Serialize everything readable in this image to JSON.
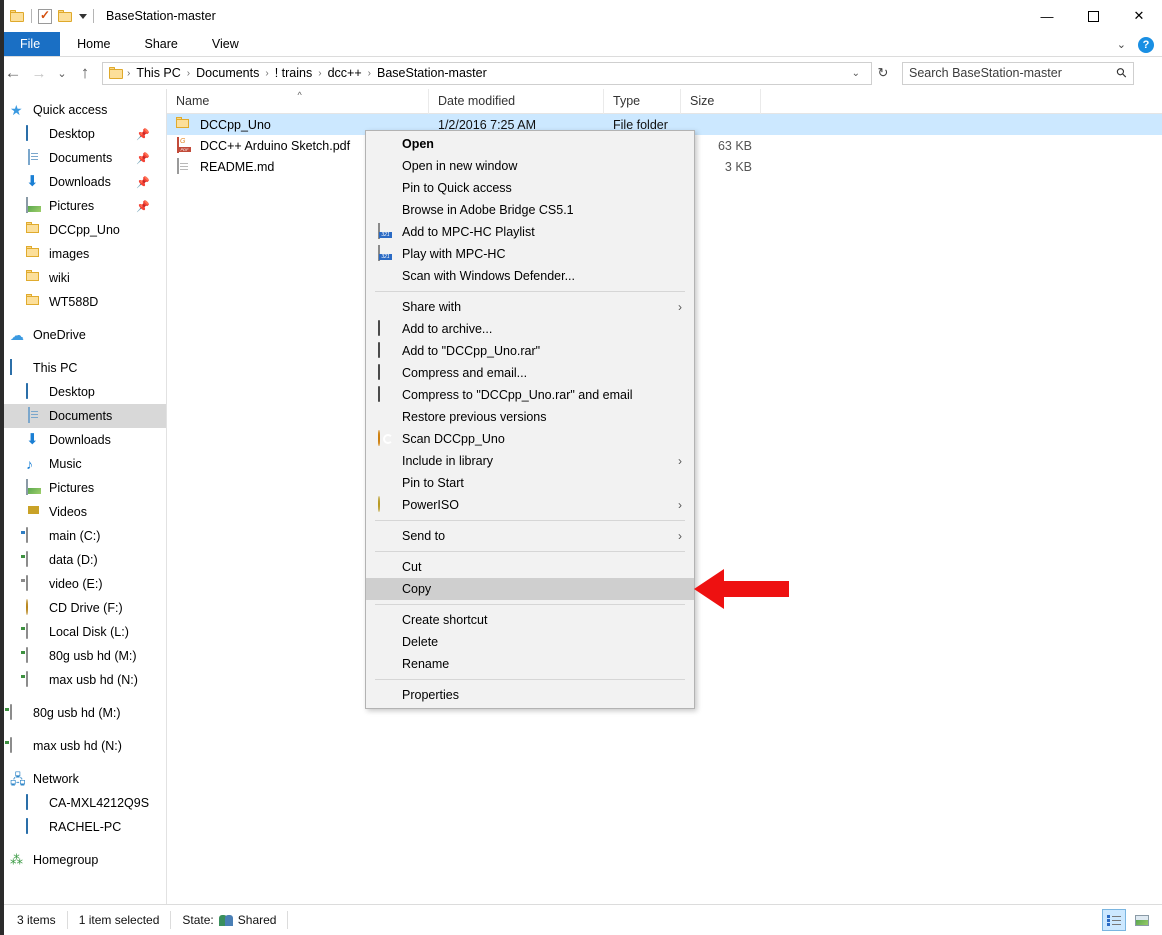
{
  "window": {
    "title": "BaseStation-master",
    "quick_access_icons": [
      "folder-icon",
      "properties-icon",
      "new-folder-icon",
      "customize-caret-icon"
    ],
    "controls": {
      "minimize": "—",
      "maximize": "▢",
      "close": "✕"
    }
  },
  "ribbon": {
    "tabs": [
      {
        "label": "File",
        "active_style": "blue"
      },
      {
        "label": "Home"
      },
      {
        "label": "Share"
      },
      {
        "label": "View"
      }
    ],
    "collapse_icon": "chevron-down-icon",
    "help_icon": "help-icon",
    "help_label": "?"
  },
  "address_bar": {
    "back_icon": "back-arrow-icon",
    "forward_icon": "forward-arrow-icon",
    "recent_icon": "recent-locations-icon",
    "up_icon": "up-arrow-icon",
    "breadcrumbs": [
      "This PC",
      "Documents",
      "! trains",
      "dcc++",
      "BaseStation-master"
    ],
    "separator": "›",
    "dropdown_icon": "address-dropdown-icon",
    "refresh_icon": "refresh-icon",
    "refresh_glyph": "↻"
  },
  "search": {
    "placeholder": "Search BaseStation-master",
    "icon": "search-icon"
  },
  "navigation_pane": {
    "groups": [
      {
        "header": {
          "label": "Quick access",
          "icon": "quick-access-star-icon"
        },
        "items": [
          {
            "label": "Desktop",
            "icon": "desktop-icon",
            "pinned": true
          },
          {
            "label": "Documents",
            "icon": "documents-icon",
            "pinned": true
          },
          {
            "label": "Downloads",
            "icon": "downloads-icon",
            "pinned": true
          },
          {
            "label": "Pictures",
            "icon": "pictures-icon",
            "pinned": true
          },
          {
            "label": "DCCpp_Uno",
            "icon": "folder-icon",
            "pinned": false
          },
          {
            "label": "images",
            "icon": "folder-icon",
            "pinned": false
          },
          {
            "label": "wiki",
            "icon": "folder-icon",
            "pinned": false
          },
          {
            "label": "WT588D",
            "icon": "folder-icon",
            "pinned": false
          }
        ]
      },
      {
        "header": {
          "label": "OneDrive",
          "icon": "onedrive-cloud-icon"
        },
        "items": []
      },
      {
        "header": {
          "label": "This PC",
          "icon": "this-pc-icon"
        },
        "items": [
          {
            "label": "Desktop",
            "icon": "desktop-icon"
          },
          {
            "label": "Documents",
            "icon": "documents-icon",
            "selected": true
          },
          {
            "label": "Downloads",
            "icon": "downloads-icon"
          },
          {
            "label": "Music",
            "icon": "music-icon"
          },
          {
            "label": "Pictures",
            "icon": "pictures-icon"
          },
          {
            "label": "Videos",
            "icon": "videos-icon"
          },
          {
            "label": "main (C:)",
            "icon": "system-drive-icon"
          },
          {
            "label": "data (D:)",
            "icon": "drive-icon"
          },
          {
            "label": "video (E:)",
            "icon": "drive-icon"
          },
          {
            "label": "CD Drive (F:)",
            "icon": "cd-drive-icon"
          },
          {
            "label": "Local Disk (L:)",
            "icon": "drive-icon"
          },
          {
            "label": "80g usb hd (M:)",
            "icon": "drive-icon"
          },
          {
            "label": "max usb hd (N:)",
            "icon": "drive-icon"
          }
        ]
      },
      {
        "header": null,
        "items": [
          {
            "label": "80g usb hd (M:)",
            "icon": "drive-icon",
            "top_level": true
          },
          {
            "label": "max usb hd (N:)",
            "icon": "drive-icon",
            "top_level": true
          }
        ]
      },
      {
        "header": {
          "label": "Network",
          "icon": "network-icon"
        },
        "items": [
          {
            "label": "CA-MXL4212Q9S",
            "icon": "computer-icon"
          },
          {
            "label": "RACHEL-PC",
            "icon": "computer-icon"
          }
        ]
      },
      {
        "header": {
          "label": "Homegroup",
          "icon": "homegroup-icon"
        },
        "items": []
      }
    ]
  },
  "file_list": {
    "columns": [
      {
        "label": "Name",
        "sorted": true,
        "sort_glyph": "^"
      },
      {
        "label": "Date modified"
      },
      {
        "label": "Type"
      },
      {
        "label": "Size"
      }
    ],
    "rows": [
      {
        "name": "DCCpp_Uno",
        "icon": "folder-icon",
        "date_modified": "1/2/2016 7:25 AM",
        "type": "File folder",
        "size": "",
        "selected": true
      },
      {
        "name": "DCC++ Arduino Sketch.pdf",
        "icon": "pdf-file-icon",
        "date_modified": "",
        "type": "",
        "size": "63 KB",
        "selected": false
      },
      {
        "name": "README.md",
        "icon": "markdown-file-icon",
        "date_modified": "",
        "type": "",
        "size": "3 KB",
        "selected": false
      }
    ]
  },
  "context_menu": {
    "items": [
      {
        "label": "Open",
        "bold": true
      },
      {
        "label": "Open in new window"
      },
      {
        "label": "Pin to Quick access"
      },
      {
        "label": "Browse in Adobe Bridge CS5.1"
      },
      {
        "label": "Add to MPC-HC Playlist",
        "icon": "mpc-hc-icon"
      },
      {
        "label": "Play with MPC-HC",
        "icon": "mpc-hc-icon"
      },
      {
        "label": "Scan with Windows Defender..."
      },
      {
        "separator": true
      },
      {
        "label": "Share with",
        "submenu": true
      },
      {
        "label": "Add to archive...",
        "icon": "winrar-icon"
      },
      {
        "label": "Add to \"DCCpp_Uno.rar\"",
        "icon": "winrar-icon"
      },
      {
        "label": "Compress and email...",
        "icon": "winrar-icon"
      },
      {
        "label": "Compress to \"DCCpp_Uno.rar\" and email",
        "icon": "winrar-icon"
      },
      {
        "label": "Restore previous versions"
      },
      {
        "label": "Scan DCCpp_Uno",
        "icon": "scan-icon"
      },
      {
        "label": "Include in library",
        "submenu": true
      },
      {
        "label": "Pin to Start"
      },
      {
        "label": "PowerISO",
        "icon": "poweriso-icon",
        "submenu": true
      },
      {
        "separator": true
      },
      {
        "label": "Send to",
        "submenu": true
      },
      {
        "separator": true
      },
      {
        "label": "Cut"
      },
      {
        "label": "Copy",
        "highlighted": true
      },
      {
        "separator": true
      },
      {
        "label": "Create shortcut"
      },
      {
        "label": "Delete"
      },
      {
        "label": "Rename"
      },
      {
        "separator": true
      },
      {
        "label": "Properties"
      }
    ],
    "submenu_glyph": "›"
  },
  "annotation": {
    "type": "red-arrow",
    "direction": "left",
    "color": "#ee1111",
    "points_at": "Copy"
  },
  "status_bar": {
    "item_count": "3 items",
    "selection": "1 item selected",
    "state_label": "State:",
    "state_value": "Shared",
    "state_icon": "shared-people-icon",
    "view_buttons": [
      {
        "name": "details-view",
        "active": true
      },
      {
        "name": "large-icons-view",
        "active": false
      }
    ]
  },
  "colors": {
    "accent_blue": "#1a6fc4",
    "selection_blue": "#cce8ff",
    "menu_bg": "#f2f2f2",
    "menu_highlight": "#cfcfcf",
    "annotation_red": "#ee1111"
  }
}
